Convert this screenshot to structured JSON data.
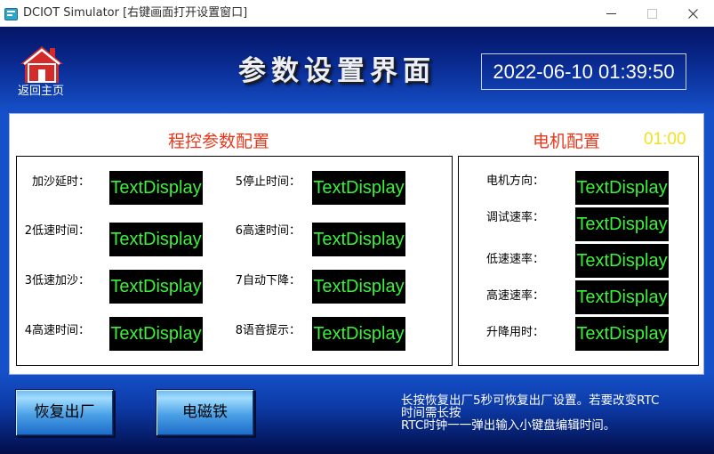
{
  "window": {
    "title": "DCIOT Simulator [右键画面打开设置窗口]",
    "icon": "app-icon",
    "controls": {
      "minimize": "minimize-icon",
      "maximize": "maximize-icon",
      "close": "close-icon",
      "maximize_enabled": false
    }
  },
  "header": {
    "home": {
      "icon": "home-icon",
      "label": "返回主页"
    },
    "title": "参数设置界面",
    "datetime": "2022-06-10 01:39:50"
  },
  "program_section": {
    "title": "程控参数配置",
    "params": [
      {
        "label": "加沙延时：",
        "value": "TextDisplay"
      },
      {
        "label": "2低速时间：",
        "value": "TextDisplay"
      },
      {
        "label": "3低速加沙：",
        "value": "TextDisplay"
      },
      {
        "label": "4高速时间：",
        "value": "TextDisplay"
      },
      {
        "label": "5停止时间：",
        "value": "TextDisplay"
      },
      {
        "label": "6高速时间：",
        "value": "TextDisplay"
      },
      {
        "label": "7自动下降：",
        "value": "TextDisplay"
      },
      {
        "label": "8语音提示：",
        "value": "TextDisplay"
      }
    ]
  },
  "motor_section": {
    "title": "电机配置",
    "timer": "01:00",
    "params": [
      {
        "label": "电机方向：",
        "value": "TextDisplay"
      },
      {
        "label": "调试速率：",
        "value": "TextDisplay"
      },
      {
        "label": "低速速率：",
        "value": "TextDisplay"
      },
      {
        "label": "高速速率：",
        "value": "TextDisplay"
      },
      {
        "label": "升降用时：",
        "value": "TextDisplay"
      }
    ]
  },
  "footer": {
    "buttons": {
      "factory_reset": "恢复出厂",
      "electromagnet": "电磁铁"
    },
    "notice": [
      "长按恢复出厂5秒可恢复出厂设置。若要改变RTC",
      "时间需长按",
      "RTC时钟一一弹出输入小键盘编辑时间。"
    ]
  },
  "colors": {
    "section_title": "#e8381c",
    "timer": "#f2e11e",
    "display_text": "#3af23a",
    "display_bg": "#000000"
  }
}
